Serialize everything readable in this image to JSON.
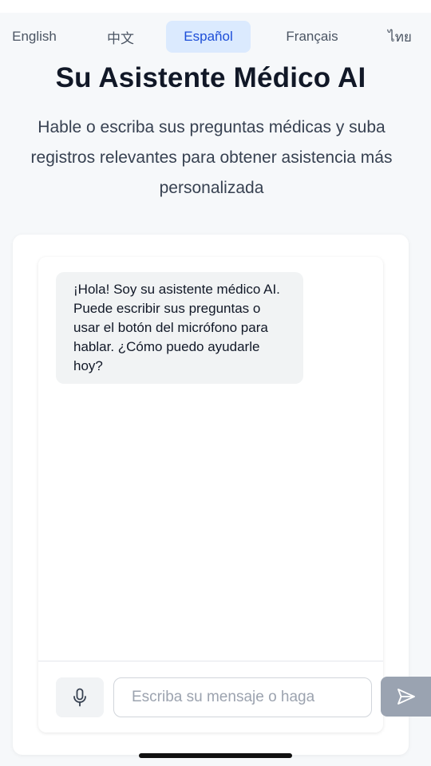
{
  "language_tabs": [
    {
      "label": "English",
      "active": false
    },
    {
      "label": "中文",
      "active": false
    },
    {
      "label": "Español",
      "active": true
    },
    {
      "label": "Français",
      "active": false
    },
    {
      "label": "ไทย",
      "active": false
    }
  ],
  "header": {
    "title": "Su Asistente Médico AI",
    "subtitle": "Hable o escriba sus preguntas médicas y suba registros relevantes para obtener asistencia más personalizada"
  },
  "chat": {
    "messages": [
      {
        "sender": "assistant",
        "text": "¡Hola! Soy su asistente médico AI. Puede escribir sus preguntas o usar el botón del micrófono para hablar. ¿Cómo puedo ayudarle hoy?"
      }
    ],
    "input": {
      "value": "",
      "placeholder": "Escriba su mensaje o haga"
    },
    "mic_icon": "microphone-icon",
    "send_icon": "send-arrow-icon"
  },
  "colors": {
    "active_tab_bg": "#dbeafe",
    "active_tab_text": "#1d4ed8",
    "send_button_bg": "#9aa3b1",
    "bubble_bg": "#f1f3f4"
  }
}
